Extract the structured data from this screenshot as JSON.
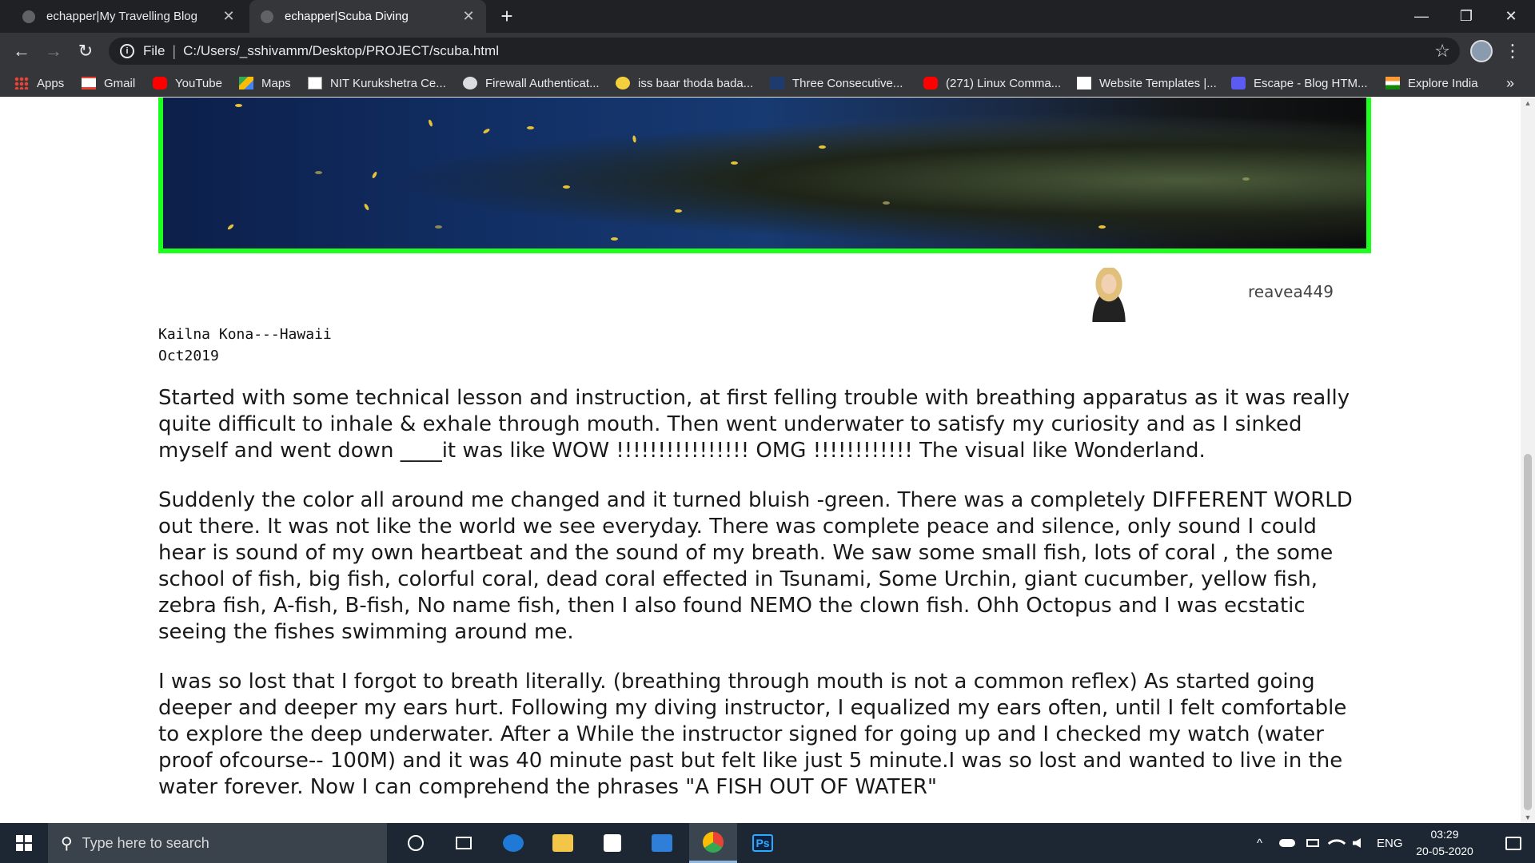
{
  "tabs": [
    {
      "title": "echapper|My Travelling Blog",
      "active": false
    },
    {
      "title": "echapper|Scuba Diving",
      "active": true
    }
  ],
  "tab_close_glyph": "✕",
  "new_tab_glyph": "+",
  "window_controls": {
    "minimize": "—",
    "restore": "❐",
    "close": "✕"
  },
  "toolbar": {
    "back_glyph": "←",
    "forward_glyph": "→",
    "reload_glyph": "↻",
    "info_glyph": "i",
    "scheme": "File",
    "separator": "|",
    "url": "C:/Users/_sshivamm/Desktop/PROJECT/scuba.html",
    "star_glyph": "☆",
    "menu_glyph": "⋮"
  },
  "bookmarks": [
    {
      "label": "Apps",
      "icon": "apps-icon"
    },
    {
      "label": "Gmail",
      "icon": "gmail-icon"
    },
    {
      "label": "YouTube",
      "icon": "youtube-icon"
    },
    {
      "label": "Maps",
      "icon": "maps-icon"
    },
    {
      "label": "NIT Kurukshetra Ce...",
      "icon": "nit-icon"
    },
    {
      "label": "Firewall Authenticat...",
      "icon": "globe-icon"
    },
    {
      "label": "iss baar thoda bada...",
      "icon": "smiley-icon"
    },
    {
      "label": "Three Consecutive...",
      "icon": "bookmark-icon"
    },
    {
      "label": "(271) Linux Comma...",
      "icon": "youtube-icon"
    },
    {
      "label": "Website Templates |...",
      "icon": "wix-icon"
    },
    {
      "label": "Escape - Blog HTM...",
      "icon": "w-icon"
    },
    {
      "label": "Explore India",
      "icon": "india-flag-icon"
    }
  ],
  "bookmarks_more_glyph": "»",
  "post": {
    "author": "reavea449",
    "location": "Kailna Kona---Hawaii",
    "date": "Oct2019",
    "paragraphs": [
      "Started with some technical lesson and instruction, at first felling trouble with breathing apparatus as it was really quite difficult to inhale & exhale through mouth. Then went underwater to satisfy my curiosity and as I sinked myself and went down ____it was like WOW !!!!!!!!!!!!!!!! OMG !!!!!!!!!!!! The visual like Wonderland.",
      "Suddenly the color all around me changed and it turned bluish -green. There was a completely DIFFERENT WORLD out there. It was not like the world we see everyday. There was complete peace and silence, only sound I could hear is sound of my own heartbeat and the sound of my breath. We saw some small fish, lots of coral , the some school of fish, big fish, colorful coral, dead coral effected in Tsunami, Some Urchin, giant cucumber, yellow fish, zebra fish, A-fish, B-fish, No name fish, then I also found NEMO the clown fish. Ohh Octopus and I was ecstatic seeing the fishes swimming around me.",
      "I was so lost that I forgot to breath literally. (breathing through mouth is not a common reflex) As started going deeper and deeper my ears hurt. Following my diving instructor, I equalized my ears often, until I felt comfortable to explore the deep underwater. After a While the instructor signed for going up and I checked my watch (water proof ofcourse-- 100M) and it was 40 minute past but felt like just 5 minute.I was so lost and wanted to live in the water forever. Now I can comprehend the phrases \"A FISH OUT OF WATER\""
    ]
  },
  "colors": {
    "banner_border": "#1dff1d",
    "chrome_dark": "#202124",
    "chrome_toolbar": "#35363a",
    "taskbar": "#1c2733"
  },
  "taskbar": {
    "search_placeholder": "Type here to search",
    "search_glyph": "⚲",
    "pinned": [
      "cortana-icon",
      "task-view-icon",
      "edge-icon",
      "file-explorer-icon",
      "store-icon",
      "mail-icon",
      "chrome-icon",
      "photoshop-icon"
    ],
    "photoshop_label": "Ps",
    "tray_chevron": "^",
    "language": "ENG",
    "time": "03:29",
    "date": "20-05-2020"
  }
}
